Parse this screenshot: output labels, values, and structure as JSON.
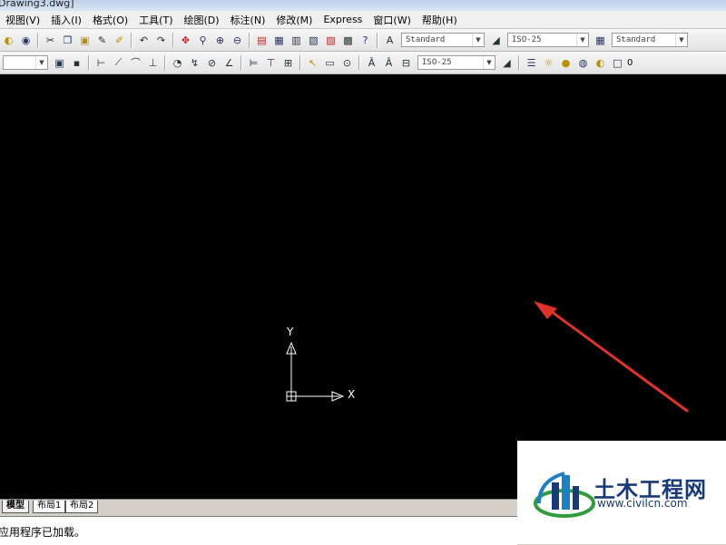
{
  "window": {
    "title": "Drawing3.dwg]"
  },
  "menubar": {
    "items": [
      "视图(V)",
      "插入(I)",
      "格式(O)",
      "工具(T)",
      "绘图(D)",
      "标注(N)",
      "修改(M)",
      "Express",
      "窗口(W)",
      "帮助(H)"
    ]
  },
  "toolbar1": {
    "text_style": "Standard",
    "dim_style": "ISO-25",
    "table_style": "Standard"
  },
  "toolbar2": {
    "dim_style": "ISO-25",
    "layer_name": "0"
  },
  "ucs": {
    "y_label": "Y",
    "x_label": "X"
  },
  "tabs": [
    "模型",
    "布局1",
    "布局2"
  ],
  "command_line": {
    "text": "应用程序已加载。"
  },
  "watermark": {
    "name": "土木工程网",
    "url": "www.civilcn.com"
  },
  "colors": {
    "canvas": "#000000",
    "annotation_arrow": "#e0322b",
    "ucs": "#ffffff",
    "watermark_blue": "#173a7a",
    "watermark_green": "#2e9d3c"
  }
}
